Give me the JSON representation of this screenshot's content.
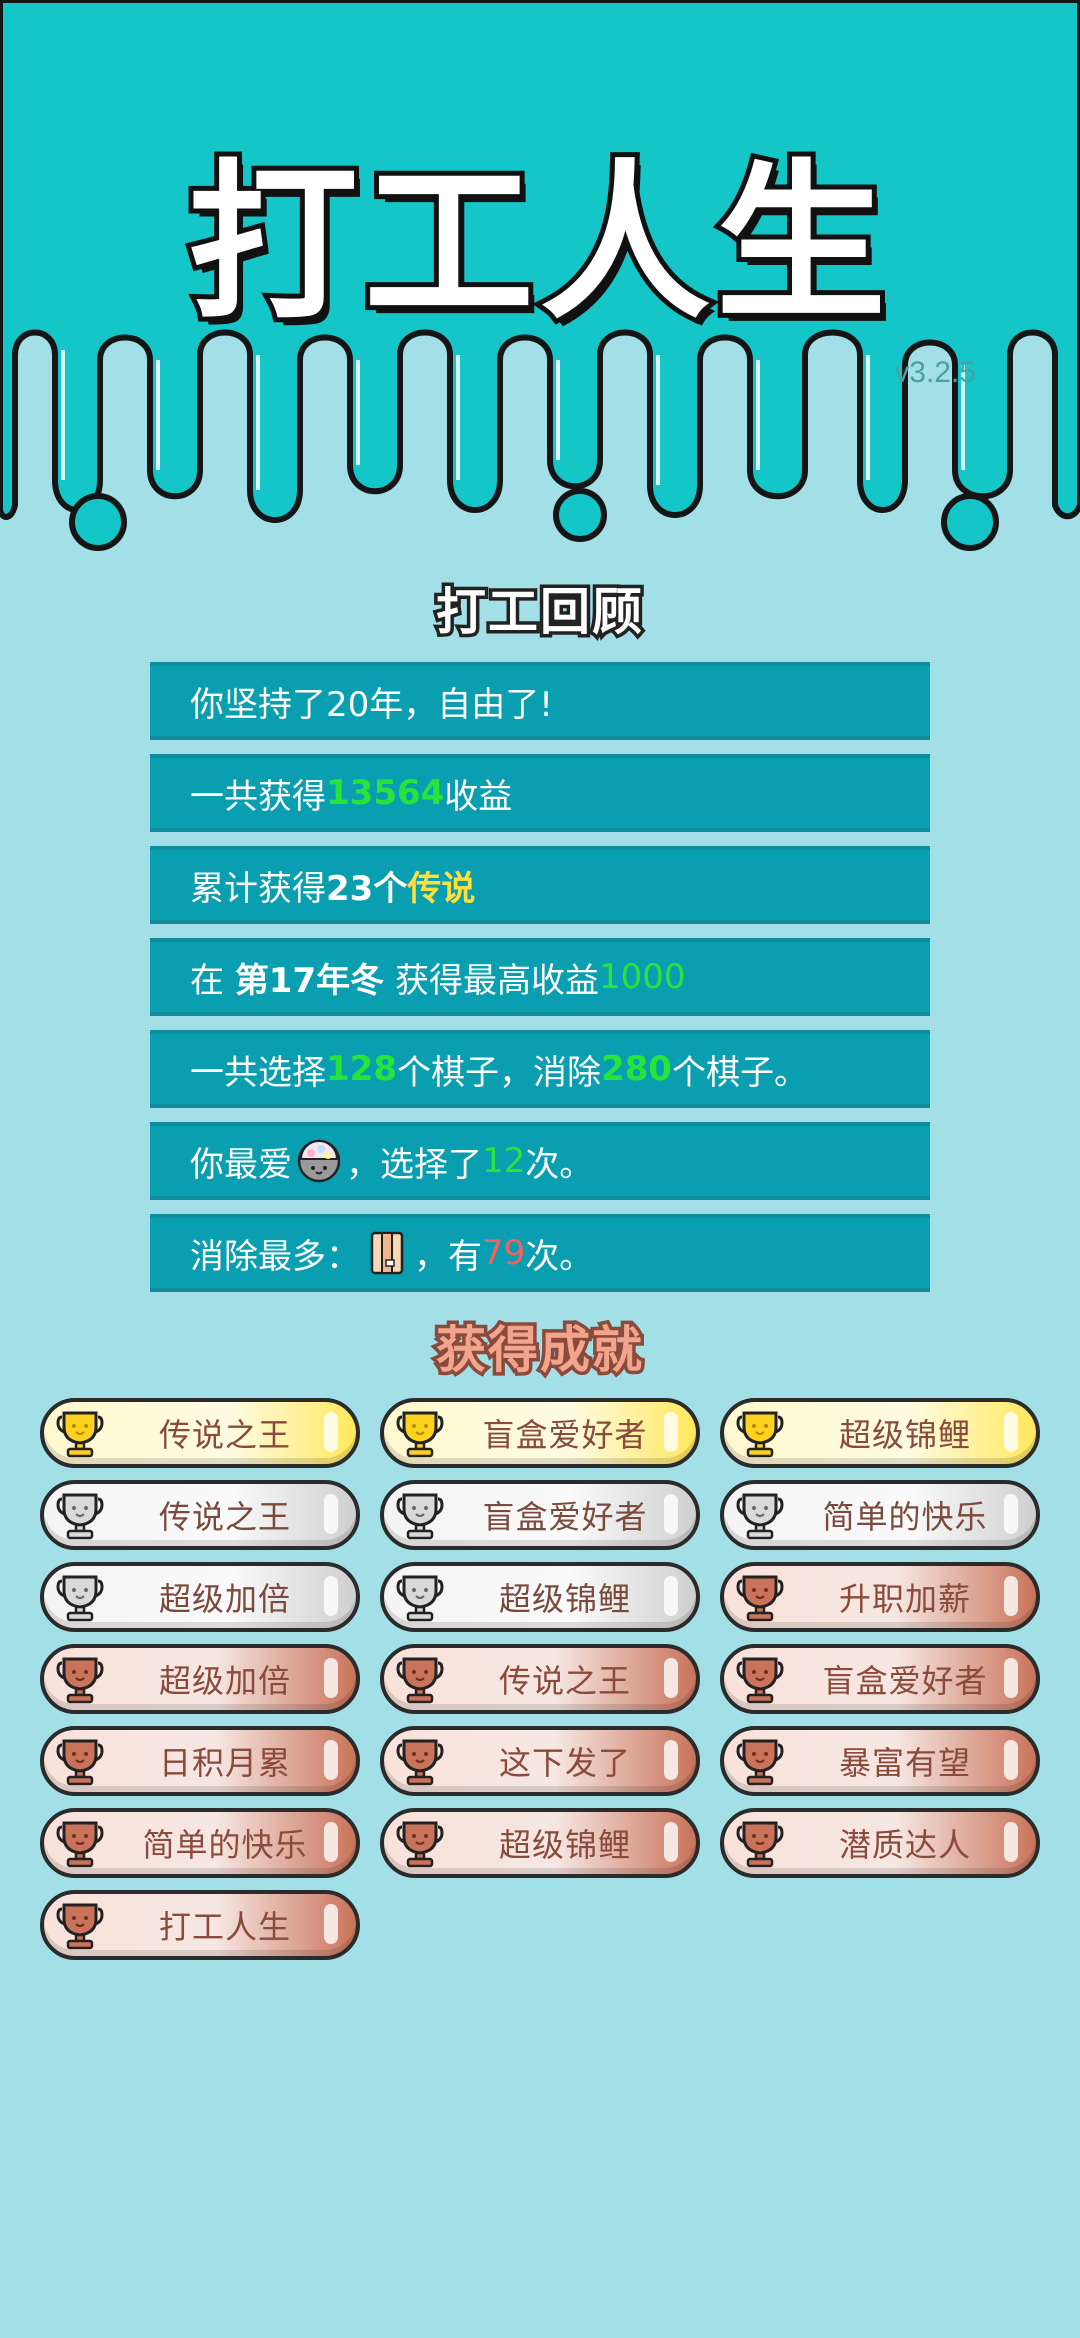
{
  "app": {
    "title": "打工人生",
    "version": "v3.2.5"
  },
  "review": {
    "title": "打工回顾",
    "years_text": "你坚持了20年，自由了!",
    "earnings_prefix": "一共获得",
    "earnings_value": "13564",
    "earnings_suffix": "收益",
    "legend_prefix": "累计获得",
    "legend_count": "23个",
    "legend_word": "传说",
    "best_prefix": "在",
    "best_period": "第17年冬",
    "best_middle": "获得最高收益",
    "best_value": "1000",
    "pieces_prefix": "一共选择",
    "pieces_selected": "128",
    "pieces_middle": "个棋子，消除",
    "pieces_cleared": "280",
    "pieces_suffix": "个棋子。",
    "fav_prefix": "你最爱",
    "fav_icon": "mystery-capsule-icon",
    "fav_middle": "，选择了",
    "fav_count": "12",
    "fav_suffix": "次。",
    "clear_prefix": "消除最多：",
    "clear_icon": "folder-book-icon",
    "clear_middle": "，有",
    "clear_count": "79",
    "clear_suffix": "次。"
  },
  "achievements": {
    "title": "获得成就",
    "items": [
      {
        "label": "传说之王",
        "tier": "gold"
      },
      {
        "label": "盲盒爱好者",
        "tier": "gold"
      },
      {
        "label": "超级锦鲤",
        "tier": "gold"
      },
      {
        "label": "传说之王",
        "tier": "silver"
      },
      {
        "label": "盲盒爱好者",
        "tier": "silver"
      },
      {
        "label": "简单的快乐",
        "tier": "silver"
      },
      {
        "label": "超级加倍",
        "tier": "silver"
      },
      {
        "label": "超级锦鲤",
        "tier": "silver"
      },
      {
        "label": "升职加薪",
        "tier": "bronze"
      },
      {
        "label": "超级加倍",
        "tier": "bronze"
      },
      {
        "label": "传说之王",
        "tier": "bronze"
      },
      {
        "label": "盲盒爱好者",
        "tier": "bronze"
      },
      {
        "label": "日积月累",
        "tier": "bronze"
      },
      {
        "label": "这下发了",
        "tier": "bronze"
      },
      {
        "label": "暴富有望",
        "tier": "bronze"
      },
      {
        "label": "简单的快乐",
        "tier": "bronze"
      },
      {
        "label": "超级锦鲤",
        "tier": "bronze"
      },
      {
        "label": "潜质达人",
        "tier": "bronze"
      },
      {
        "label": "打工人生",
        "tier": "bronze"
      }
    ]
  },
  "colors": {
    "header_bg": "#14c6c8",
    "page_bg": "#a3dfe6",
    "row_bg": "#0a9fb0",
    "highlight_green": "#27e43a",
    "highlight_red": "#ff5c5c",
    "legend_yellow": "#ffe03a",
    "gold_accent": "#ffe85c",
    "silver_accent": "#cfcfcf",
    "bronze_accent": "#c9735a"
  }
}
